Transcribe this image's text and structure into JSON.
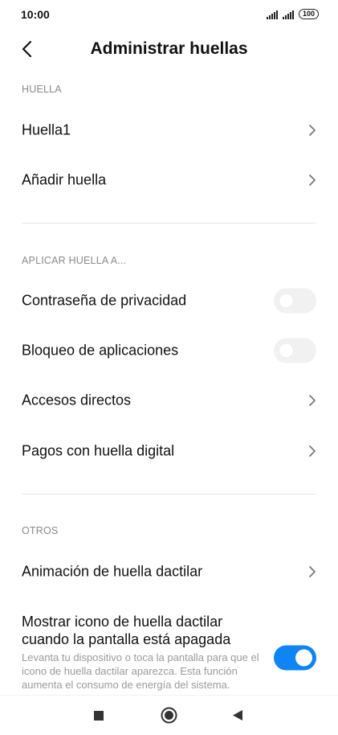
{
  "status_bar": {
    "time": "10:00",
    "battery": "100",
    "icons": [
      "signal-icon",
      "signal-icon",
      "battery-icon"
    ]
  },
  "header": {
    "title": "Administrar huellas",
    "back_icon": "back-arrow-icon"
  },
  "sections": {
    "huella": {
      "header": "HUELLA",
      "items": [
        {
          "label": "Huella1",
          "control": "chevron"
        },
        {
          "label": "Añadir huella",
          "control": "chevron"
        }
      ]
    },
    "aplicar": {
      "header": "APLICAR HUELLA A...",
      "items": [
        {
          "label": "Contraseña de privacidad",
          "control": "toggle",
          "checked": false
        },
        {
          "label": "Bloqueo de aplicaciones",
          "control": "toggle",
          "checked": false
        },
        {
          "label": "Accesos directos",
          "control": "chevron"
        },
        {
          "label": "Pagos con huella digital",
          "control": "chevron"
        }
      ]
    },
    "otros": {
      "header": "OTROS",
      "items": [
        {
          "label": "Animación de huella dactilar",
          "control": "chevron"
        },
        {
          "label": "Mostrar icono de huella dactilar cuando la pantalla está apagada",
          "description": "Levanta tu dispositivo o toca la pantalla para que el icono de huella dactilar aparezca. Esta función aumenta el consumo de energía del sistema.",
          "control": "toggle",
          "checked": true
        }
      ]
    }
  },
  "nav_bar": {
    "icons": [
      "recents-square-icon",
      "home-circle-icon",
      "back-triangle-icon"
    ]
  },
  "colors": {
    "accent": "#0e84f5",
    "toggle_off": "#f1f1f1",
    "section_header": "#8a8a8a",
    "description": "#9a9a9a"
  }
}
